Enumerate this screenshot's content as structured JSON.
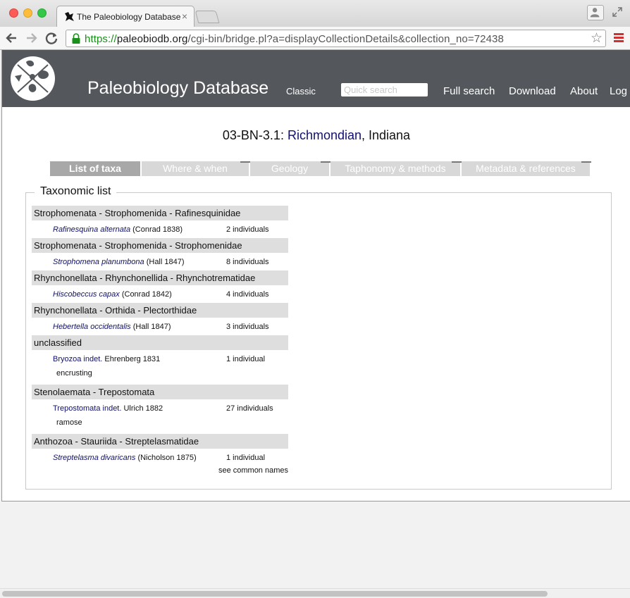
{
  "browser": {
    "tab_title": "The Paleobiology Database",
    "tab_close": "×",
    "url_scheme": "https://",
    "url_host": "paleobiodb.org",
    "url_path": "/cgi-bin/bridge.pl?a=displayCollectionDetails&collection_no=72438"
  },
  "header": {
    "site_title": "Paleobiology Database",
    "classic": "Classic",
    "search_placeholder": "Quick search",
    "nav": [
      "Full search",
      "Download",
      "About",
      "Log"
    ]
  },
  "collection": {
    "id": "03-BN-3.1: ",
    "stage": "Richmondian",
    "location": ", Indiana"
  },
  "tabs": [
    "List of taxa",
    "Where & when",
    "Geology",
    "Taphonomy & methods",
    "Metadata & references"
  ],
  "taxonomic_list": {
    "legend": "Taxonomic list",
    "groups": [
      {
        "header": "Strophomenata - Strophomenida - Rafinesquinidae",
        "taxon": "Rafinesquina alternata",
        "author": " (Conrad 1838)",
        "count": "2 individuals"
      },
      {
        "header": "Strophomenata - Strophomenida - Strophomenidae",
        "taxon": "Strophomena planumbona",
        "author": " (Hall 1847)",
        "count": "8 individuals"
      },
      {
        "header": "Rhynchonellata - Rhynchonellida - Rhynchotrematidae",
        "taxon": "Hiscobeccus capax",
        "author": " (Conrad 1842)",
        "count": "4 individuals"
      },
      {
        "header": "Rhynchonellata - Orthida - Plectorthidae",
        "taxon": "Hebertella occidentalis",
        "author": " (Hall 1847)",
        "count": "3 individuals"
      },
      {
        "header": "unclassified",
        "taxon": "Bryozoa indet.",
        "author": " Ehrenberg 1831",
        "count": "1 individual",
        "note": "encrusting"
      },
      {
        "header": "Stenolaemata - Trepostomata",
        "taxon": "Trepostomata indet.",
        "author": " Ulrich 1882",
        "count": "27 individuals",
        "note": "ramose"
      },
      {
        "header": "Anthozoa - Stauriida - Streptelasmatidae",
        "taxon": "Streptelasma divaricans",
        "author": " (Nicholson 1875)",
        "count": "1 individual"
      }
    ],
    "common_names_link": "see common names"
  },
  "colors": {
    "header_bg": "#54585c",
    "link": "#10106a",
    "tab_active": "#a8a8a8",
    "tab_inactive": "#d8d8d8"
  },
  "icons": [
    "favicon-icon",
    "lock-icon",
    "star-icon",
    "menu-icon",
    "back-icon",
    "forward-icon",
    "reload-icon",
    "profile-icon",
    "fullscreen-icon",
    "logo"
  ]
}
